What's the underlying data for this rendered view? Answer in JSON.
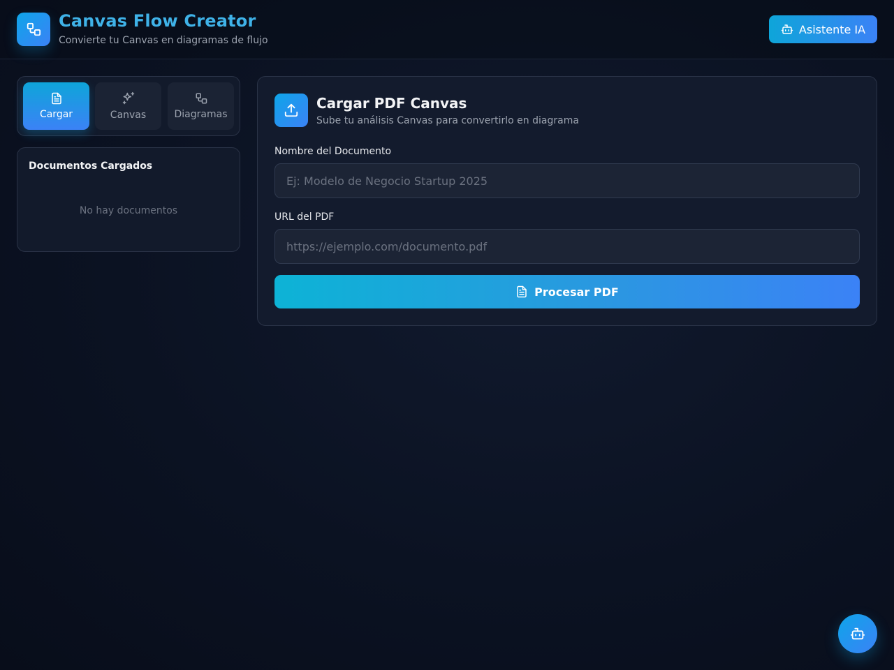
{
  "header": {
    "title": "Canvas Flow Creator",
    "subtitle": "Convierte tu Canvas en diagramas de flujo",
    "logo_icon": "flow-diagram-icon",
    "assistant_button": {
      "label": "Asistente IA",
      "icon": "bot-icon"
    }
  },
  "sidebar": {
    "tabs": [
      {
        "label": "Cargar",
        "icon": "file-text-icon",
        "active": true
      },
      {
        "label": "Canvas",
        "icon": "sparkles-icon",
        "active": false
      },
      {
        "label": "Diagramas",
        "icon": "flow-diagram-icon",
        "active": false
      }
    ],
    "documents": {
      "title": "Documentos Cargados",
      "empty_text": "No hay documentos"
    }
  },
  "main": {
    "icon": "upload-icon",
    "title": "Cargar PDF Canvas",
    "subtitle": "Sube tu análisis Canvas para convertirlo en diagrama",
    "fields": {
      "name": {
        "label": "Nombre del Documento",
        "value": "",
        "placeholder": "Ej: Modelo de Negocio Startup 2025"
      },
      "url": {
        "label": "URL del PDF",
        "value": "",
        "placeholder": "https://ejemplo.com/documento.pdf"
      }
    },
    "submit": {
      "label": "Procesar PDF",
      "icon": "file-text-icon"
    }
  },
  "fab": {
    "icon": "bot-icon"
  },
  "colors": {
    "accent_start": "#0ea5e9",
    "accent_end": "#3b82f6",
    "title": "#3fb2e8",
    "background": "#0b1222"
  }
}
